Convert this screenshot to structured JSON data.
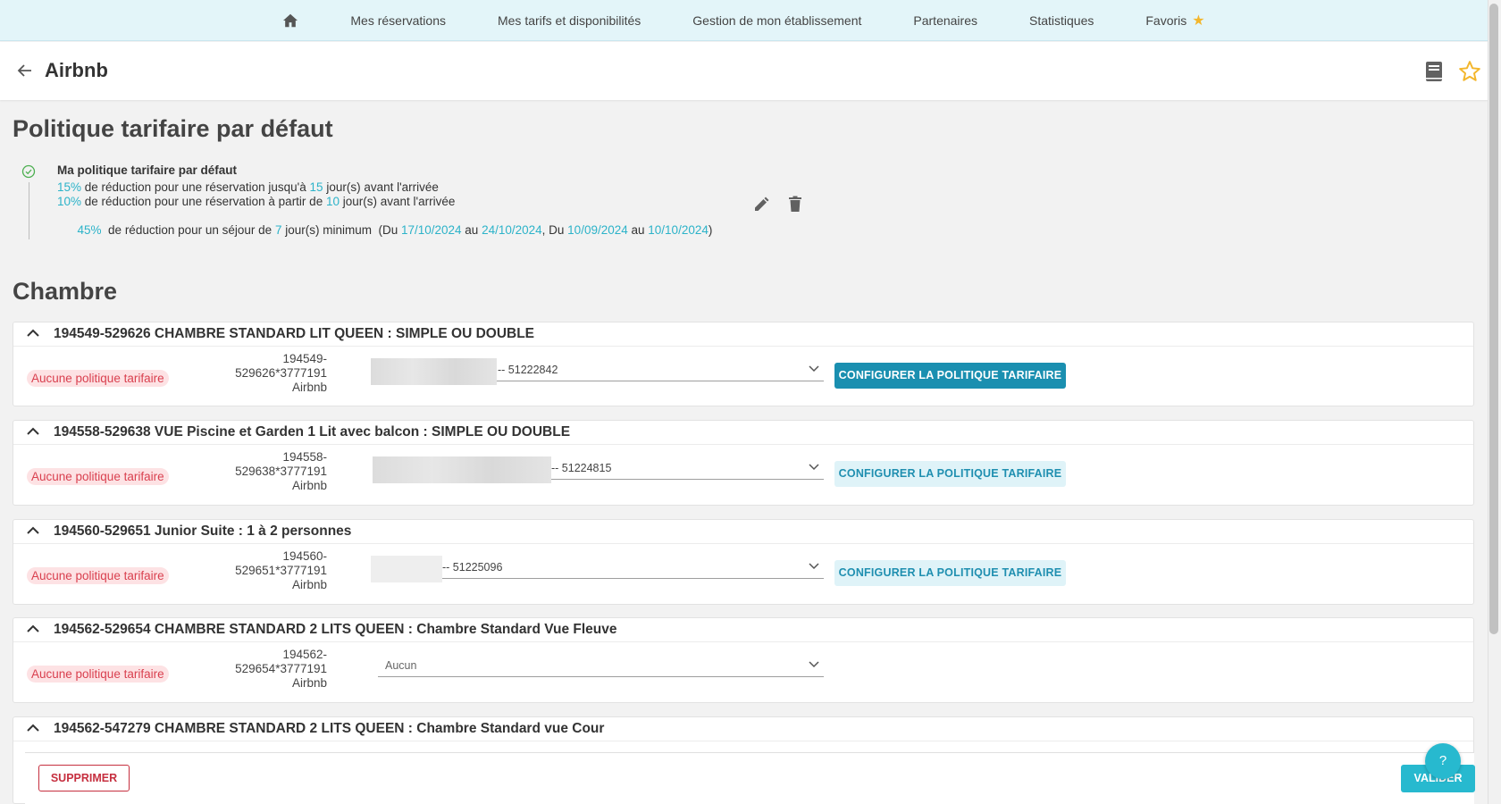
{
  "nav": {
    "items": [
      {
        "label": "Mes réservations"
      },
      {
        "label": "Mes tarifs et disponibilités"
      },
      {
        "label": "Gestion de mon établissement"
      },
      {
        "label": "Partenaires"
      },
      {
        "label": "Statistiques"
      },
      {
        "label": "Favoris"
      }
    ]
  },
  "header": {
    "title": "Airbnb"
  },
  "policy": {
    "heading": "Politique tarifaire par défaut",
    "title": "Ma politique tarifaire par défaut",
    "line1": {
      "pct": "15%",
      "a": " de réduction pour une réservation jusqu'à ",
      "days": "15",
      "b": " jour(s) avant l'arrivée"
    },
    "line2": {
      "pct": "10%",
      "a": " de réduction pour une réservation à partir de ",
      "days": "10",
      "b": " jour(s) avant l'arrivée"
    },
    "line3": {
      "pct": "45%",
      "a": "  de réduction pour un séjour de ",
      "days": "7",
      "b": " jour(s) minimum  (Du ",
      "d1": "17/10/2024",
      "au1": " au ",
      "d2": "24/10/2024",
      "sep": ", Du ",
      "d3": "10/09/2024",
      "au2": " au ",
      "d4": "10/10/2024",
      "end": ")"
    }
  },
  "rooms_heading": "Chambre",
  "rooms": [
    {
      "title": "194549-529626 CHAMBRE STANDARD LIT QUEEN : SIMPLE OU DOUBLE",
      "status": "Aucune politique tarifaire",
      "id_line1": "194549-",
      "id_line2": "529626*3777191",
      "id_line3": "Airbnb",
      "select_value": "-- 51222842",
      "button": "CONFIGURER LA POLITIQUE TARIFAIRE"
    },
    {
      "title": "194558-529638 VUE Piscine et Garden 1 Lit avec balcon : SIMPLE OU DOUBLE",
      "status": "Aucune politique tarifaire",
      "id_line1": "194558-",
      "id_line2": "529638*3777191",
      "id_line3": "Airbnb",
      "select_value": "-- 51224815",
      "button": "CONFIGURER LA POLITIQUE TARIFAIRE"
    },
    {
      "title": "194560-529651 Junior Suite : 1 à 2 personnes",
      "status": "Aucune politique tarifaire",
      "id_line1": "194560-",
      "id_line2": "529651*3777191",
      "id_line3": "Airbnb",
      "select_value": "-- 51225096",
      "button": "CONFIGURER LA POLITIQUE TARIFAIRE"
    },
    {
      "title": "194562-529654 CHAMBRE STANDARD 2 LITS QUEEN : Chambre Standard Vue Fleuve",
      "status": "Aucune politique tarifaire",
      "id_line1": "194562-",
      "id_line2": "529654*3777191",
      "id_line3": "Airbnb",
      "select_value": "Aucun"
    },
    {
      "title": "194562-547279 CHAMBRE STANDARD 2 LITS QUEEN : Chambre Standard vue Cour"
    }
  ],
  "actions": {
    "delete": "SUPPRIMER",
    "validate": "VALIDER",
    "help": "?"
  }
}
